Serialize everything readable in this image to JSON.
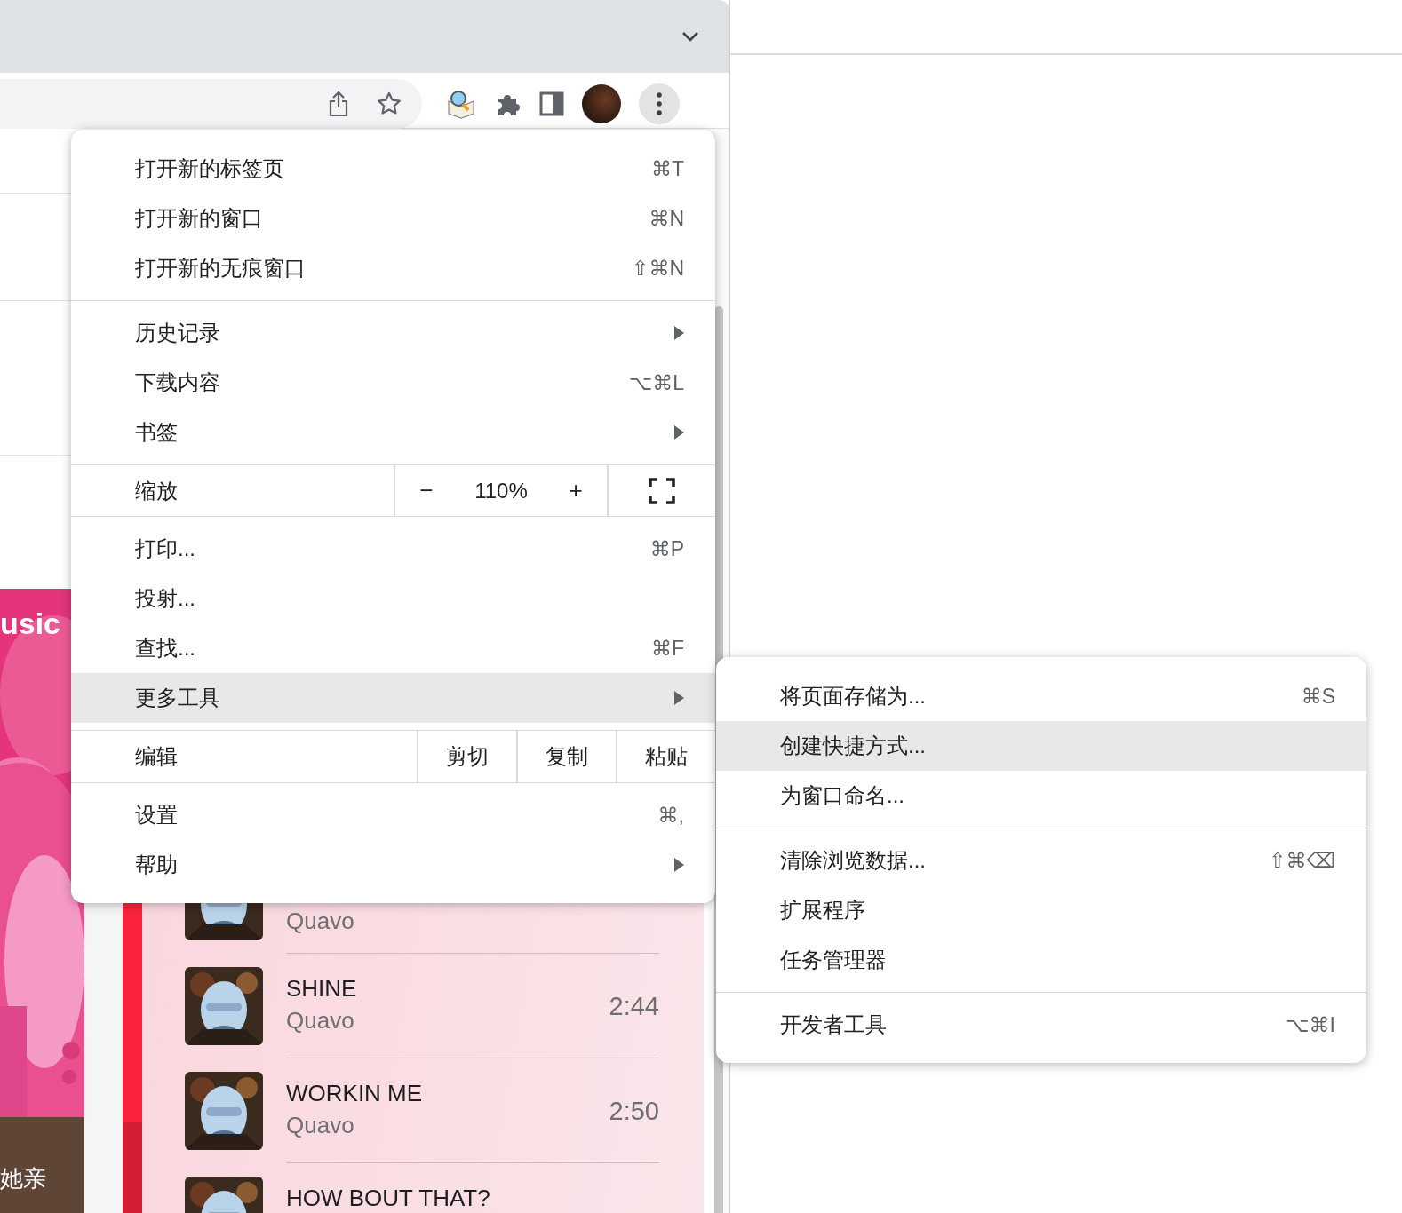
{
  "page": {
    "banner_text": "usic",
    "caption": "她亲",
    "songs": [
      {
        "artist": "Quavo"
      },
      {
        "title": "SHINE",
        "artist": "Quavo",
        "duration": "2:44"
      },
      {
        "title": "WORKIN ME",
        "artist": "Quavo",
        "duration": "2:50"
      },
      {
        "title": "HOW BOUT THAT?"
      }
    ]
  },
  "menu": {
    "sections": [
      {
        "items": [
          {
            "kind": "command",
            "label": "打开新的标签页",
            "shortcut": "⌘T",
            "has_submenu": false,
            "selected": false
          },
          {
            "kind": "command",
            "label": "打开新的窗口",
            "shortcut": "⌘N",
            "has_submenu": false,
            "selected": false
          },
          {
            "kind": "command",
            "label": "打开新的无痕窗口",
            "shortcut": "⇧⌘N",
            "has_submenu": false,
            "selected": false
          }
        ]
      },
      {
        "items": [
          {
            "kind": "command",
            "label": "历史记录",
            "has_submenu": true,
            "selected": false
          },
          {
            "kind": "command",
            "label": "下载内容",
            "shortcut": "⌥⌘L",
            "has_submenu": false,
            "selected": false
          },
          {
            "kind": "command",
            "label": "书签",
            "has_submenu": true,
            "selected": false
          }
        ]
      },
      {
        "items": [
          {
            "kind": "zoom",
            "label": "缩放",
            "minus": "−",
            "value": "110%",
            "plus": "+"
          }
        ]
      },
      {
        "items": [
          {
            "kind": "command",
            "label": "打印...",
            "shortcut": "⌘P",
            "has_submenu": false,
            "selected": false
          },
          {
            "kind": "command",
            "label": "投射...",
            "has_submenu": false,
            "selected": false
          },
          {
            "kind": "command",
            "label": "查找...",
            "shortcut": "⌘F",
            "has_submenu": false,
            "selected": false
          },
          {
            "kind": "command",
            "label": "更多工具",
            "has_submenu": true,
            "selected": true
          }
        ]
      },
      {
        "items": [
          {
            "kind": "edit",
            "label": "编辑",
            "actions": [
              "剪切",
              "复制",
              "粘贴"
            ]
          }
        ]
      },
      {
        "items": [
          {
            "kind": "command",
            "label": "设置",
            "shortcut": "⌘,",
            "has_submenu": false,
            "selected": false
          },
          {
            "kind": "command",
            "label": "帮助",
            "has_submenu": true,
            "selected": false
          }
        ]
      }
    ]
  },
  "submenu": {
    "sections": [
      {
        "items": [
          {
            "kind": "command",
            "label": "将页面存储为...",
            "shortcut": "⌘S",
            "has_submenu": false,
            "selected": false
          },
          {
            "kind": "command",
            "label": "创建快捷方式...",
            "has_submenu": false,
            "selected": true
          },
          {
            "kind": "command",
            "label": "为窗口命名...",
            "has_submenu": false,
            "selected": false
          }
        ]
      },
      {
        "items": [
          {
            "kind": "command",
            "label": "清除浏览数据...",
            "shortcut": "⇧⌘⌫",
            "has_submenu": false,
            "selected": false
          },
          {
            "kind": "command",
            "label": "扩展程序",
            "has_submenu": false,
            "selected": false
          },
          {
            "kind": "command",
            "label": "任务管理器",
            "has_submenu": false,
            "selected": false
          }
        ]
      },
      {
        "items": [
          {
            "kind": "command",
            "label": "开发者工具",
            "shortcut": "⌥⌘I",
            "has_submenu": false,
            "selected": false
          }
        ]
      }
    ]
  }
}
